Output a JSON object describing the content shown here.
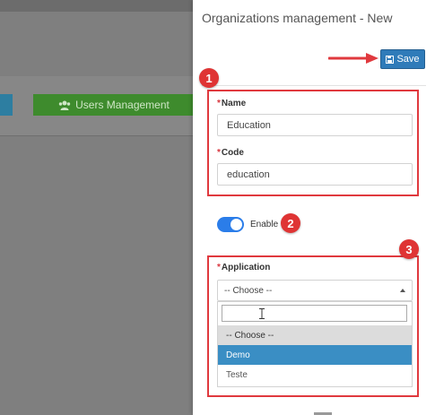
{
  "background": {
    "users_management_label": "Users Management"
  },
  "panel": {
    "title": "Organizations management - New",
    "save_label": "Save"
  },
  "form": {
    "name_label": "Name",
    "name_value": "Education",
    "code_label": "Code",
    "code_value": "education",
    "enable_label": "Enable",
    "enable_on": true,
    "application_label": "Application",
    "application_selected": "-- Choose --",
    "required_marker": "*",
    "options": [
      "-- Choose --",
      "Demo",
      "Teste"
    ],
    "highlighted_option": "Demo"
  },
  "annotations": {
    "badges": [
      "1",
      "2",
      "3"
    ]
  },
  "colors": {
    "primary": "#2f7bb9",
    "toggle": "#2b7de9",
    "annotation": "#e0393e",
    "users_button": "#3e8b2d"
  }
}
